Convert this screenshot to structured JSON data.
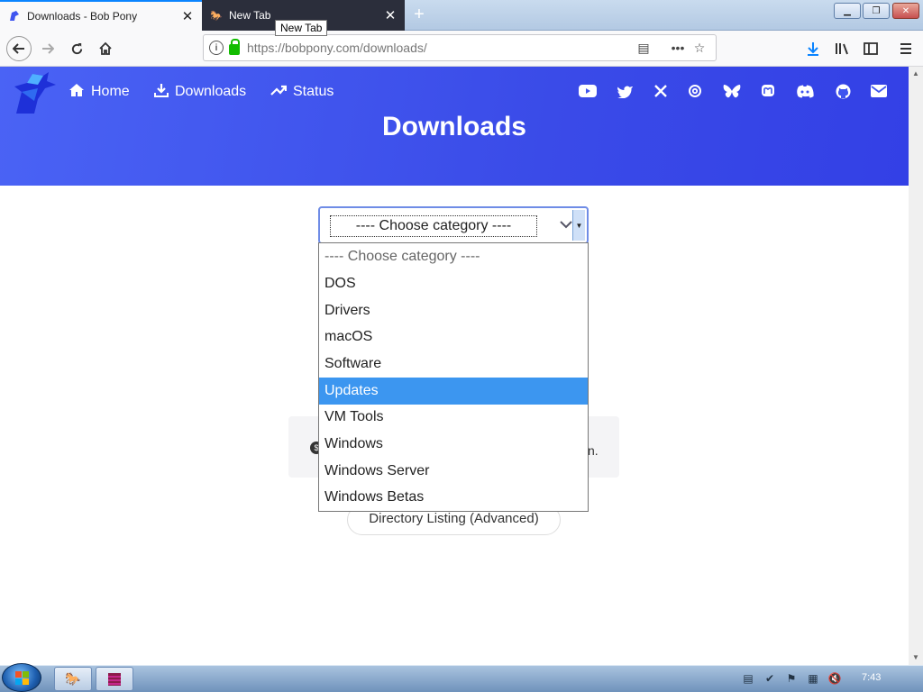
{
  "browser": {
    "tabs": [
      {
        "title": "Downloads - Bob Pony",
        "active": true
      },
      {
        "title": "New Tab",
        "active": false
      }
    ],
    "tooltip": "New Tab",
    "url_host": "https://bobpony.com",
    "url_path": "/downloads/"
  },
  "site": {
    "nav": [
      {
        "label": "Home",
        "icon": "home-icon"
      },
      {
        "label": "Downloads",
        "icon": "download-icon"
      },
      {
        "label": "Status",
        "icon": "trending-up-icon"
      }
    ],
    "social_icons": [
      "youtube-icon",
      "twitter-icon",
      "x-icon",
      "threads-icon",
      "bluesky-icon",
      "mastodon-icon",
      "discord-icon",
      "github-icon",
      "mail-icon"
    ],
    "heading": "Downloads",
    "accent": "#3f55ef"
  },
  "category_select": {
    "value": "---- Choose category ----",
    "options": [
      "---- Choose category ----",
      "DOS",
      "Drivers",
      "macOS",
      "Software",
      "Updates",
      "VM Tools",
      "Windows",
      "Windows Server",
      "Windows Betas"
    ],
    "highlighted": "Updates"
  },
  "info_fragment": "n.",
  "directory_button": "Directory Listing (Advanced)",
  "taskbar": {
    "clock": "7:43"
  }
}
